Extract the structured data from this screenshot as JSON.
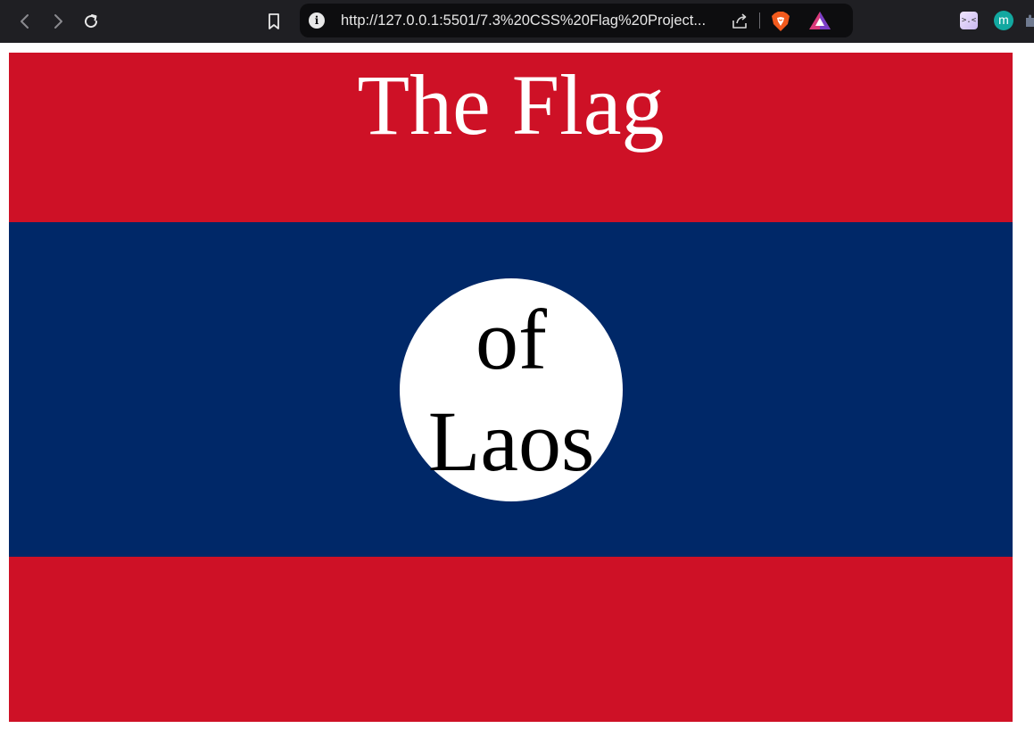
{
  "browser": {
    "url": "http://127.0.0.1:5501/7.3%20CSS%20Flag%20Project...",
    "avatar_initial": "m",
    "extension_glyph": ">.<",
    "icons": {
      "back": "chevron-left-icon",
      "forward": "chevron-right-icon",
      "reload": "reload-icon",
      "bookmark": "bookmark-icon",
      "site_info": "info-icon",
      "share": "share-icon",
      "brave_shields": "brave-lion-icon",
      "brave_rewards": "brave-rewards-triangle-icon"
    }
  },
  "page": {
    "heading": "The Flag",
    "disc_line_1": "of",
    "disc_line_2": "Laos",
    "colors": {
      "red": "#ce1126",
      "blue": "#002868",
      "disc": "#ffffff",
      "heading_text": "#ffffff",
      "disc_text": "#000000"
    }
  }
}
